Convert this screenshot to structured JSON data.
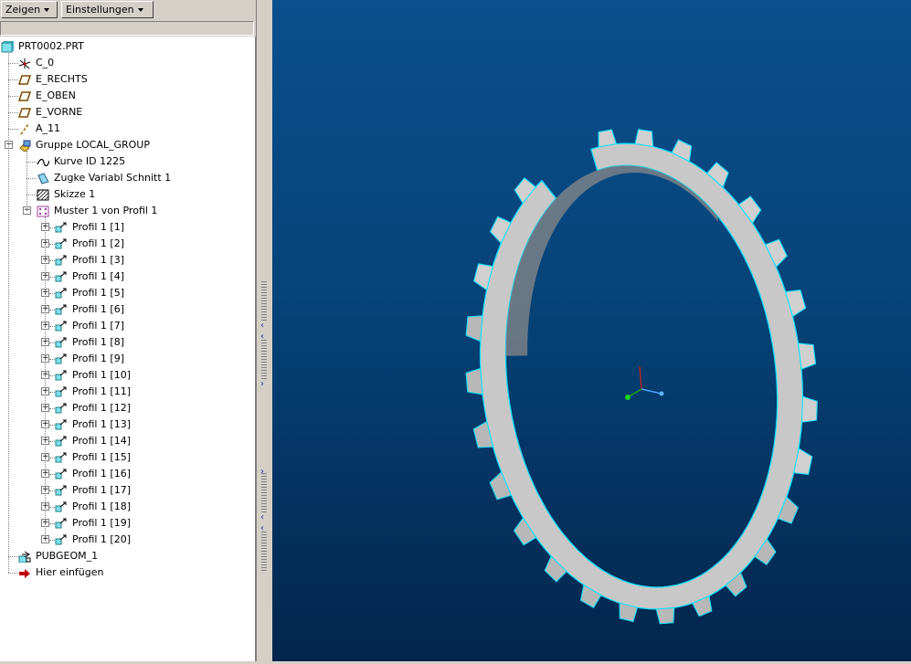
{
  "toolbar": {
    "show_label": "Zeigen",
    "settings_label": "Einstellungen"
  },
  "tree": {
    "root": "PRT0002.PRT",
    "top_items": [
      "C_0",
      "E_RECHTS",
      "E_OBEN",
      "E_VORNE",
      "A_11"
    ],
    "group": {
      "label": "Gruppe LOCAL_GROUP",
      "children": [
        "Kurve ID 1225",
        "Zugke Variabl Schnitt 1",
        "Skizze 1"
      ],
      "pattern": {
        "label": "Muster 1 von Profil 1",
        "items": [
          "Profil 1 [1]",
          "Profil 1 [2]",
          "Profil 1 [3]",
          "Profil 1 [4]",
          "Profil 1 [5]",
          "Profil 1 [6]",
          "Profil 1 [7]",
          "Profil 1 [8]",
          "Profil 1 [9]",
          "Profil 1 [10]",
          "Profil 1 [11]",
          "Profil 1 [12]",
          "Profil 1 [13]",
          "Profil 1 [14]",
          "Profil 1 [15]",
          "Profil 1 [16]",
          "Profil 1 [17]",
          "Profil 1 [18]",
          "Profil 1 [19]",
          "Profil 1 [20]"
        ]
      }
    },
    "bottom_items": [
      "PUBGEOM_1",
      "Hier einfügen"
    ]
  },
  "viewport": {
    "model": "gear-ring-model",
    "colors": {
      "background_top": "#0a4f8e",
      "background_bottom": "#02254d",
      "face": "#c8c8c8",
      "edge": "#00e5ff"
    }
  }
}
